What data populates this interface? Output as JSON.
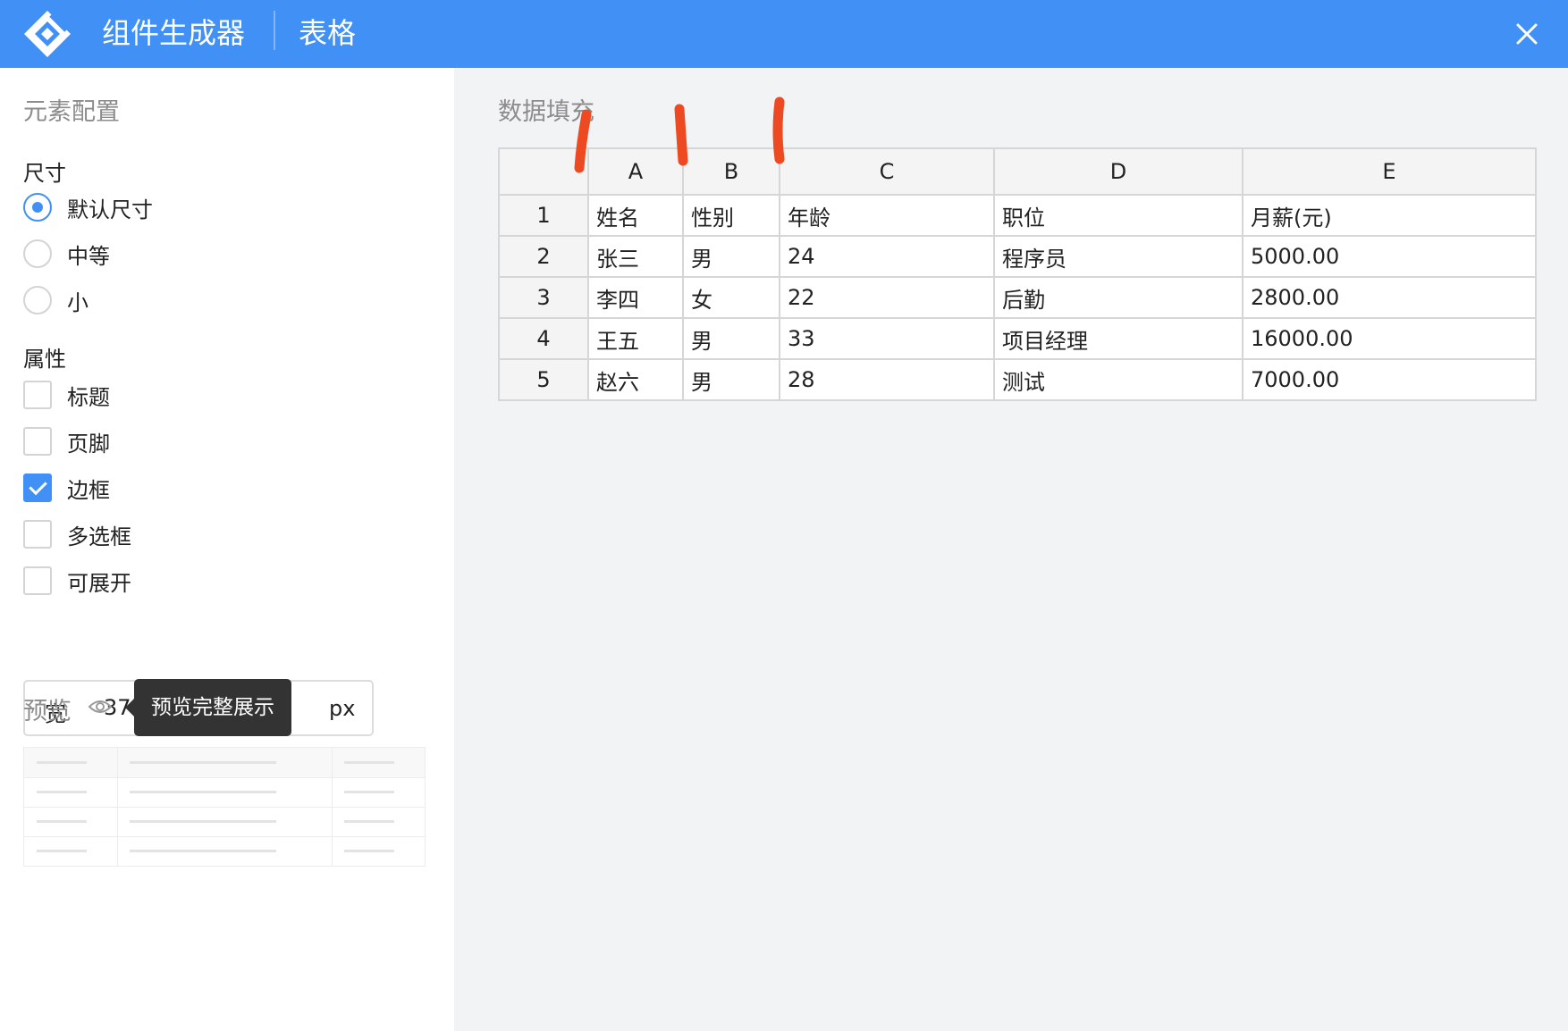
{
  "header": {
    "app_title": "组件生成器",
    "subtitle": "表格",
    "logo_icon": "diamond-logo-icon",
    "close_icon": "close-icon"
  },
  "sidebar": {
    "section_title": "元素配置",
    "size": {
      "label": "尺寸",
      "options": [
        "默认尺寸",
        "中等",
        "小"
      ],
      "selected": "默认尺寸"
    },
    "props": {
      "label": "属性",
      "options": [
        "标题",
        "页脚",
        "边框",
        "多选框",
        "可展开"
      ],
      "checked": [
        "边框"
      ]
    },
    "width": {
      "label": "宽",
      "value": "375",
      "unit": "px"
    },
    "preview": {
      "label": "预览",
      "tooltip": "预览完整展示",
      "icon": "eye-icon"
    }
  },
  "main": {
    "section_title": "数据填充",
    "columns": [
      "A",
      "B",
      "C",
      "D",
      "E"
    ],
    "rows": [
      {
        "num": "1",
        "cells": [
          "姓名",
          "性别",
          "年龄",
          "职位",
          "月薪(元)"
        ]
      },
      {
        "num": "2",
        "cells": [
          "张三",
          "男",
          "24",
          "程序员",
          "5000.00"
        ]
      },
      {
        "num": "3",
        "cells": [
          "李四",
          "女",
          "22",
          "后勤",
          "2800.00"
        ]
      },
      {
        "num": "4",
        "cells": [
          "王五",
          "男",
          "33",
          "项目经理",
          "16000.00"
        ]
      },
      {
        "num": "5",
        "cells": [
          "赵六",
          "男",
          "28",
          "测试",
          "7000.00"
        ]
      }
    ]
  },
  "colors": {
    "accent": "#4090f5",
    "annotation": "#ee4a22"
  }
}
